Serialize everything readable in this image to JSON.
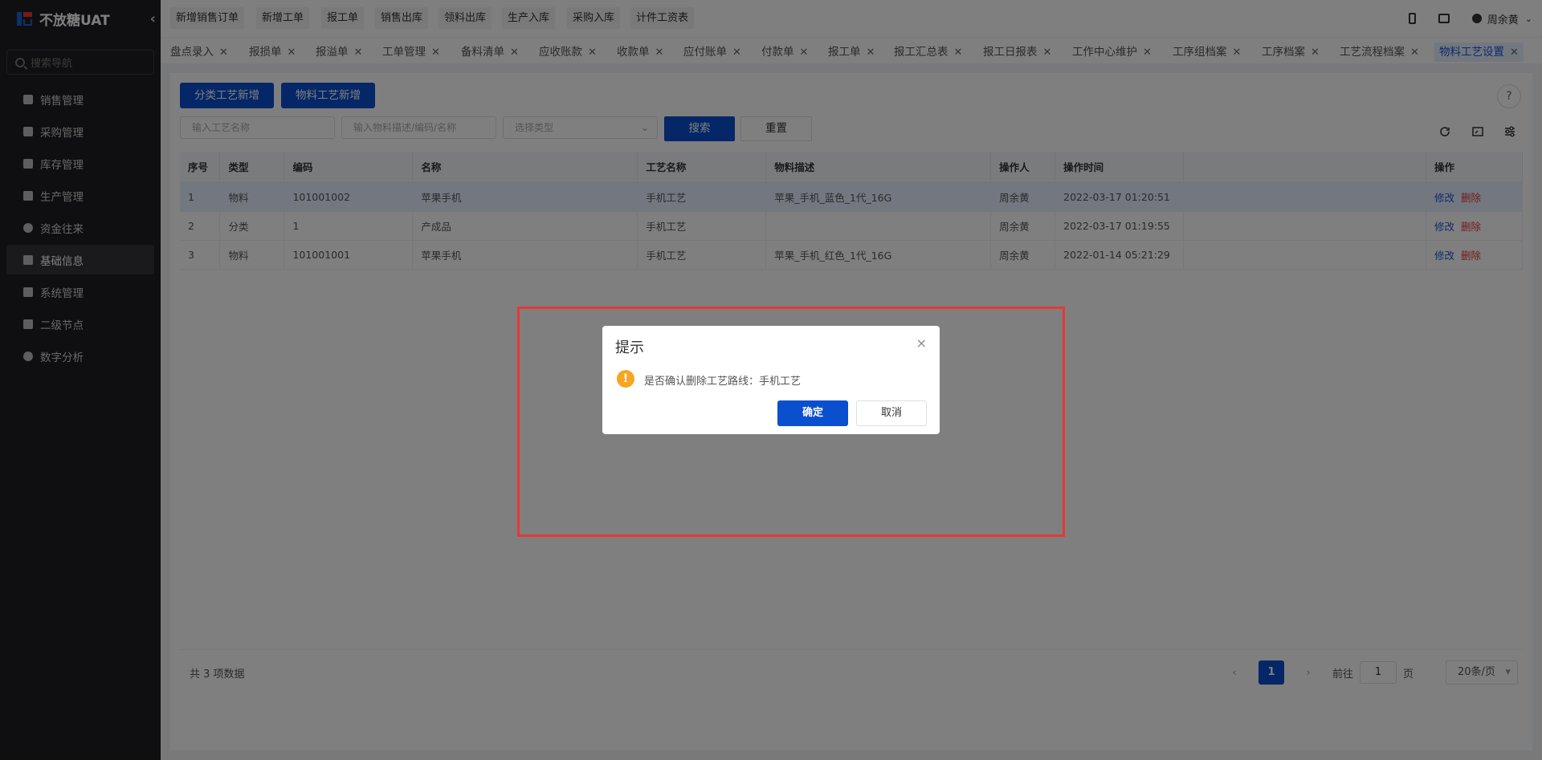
{
  "app": {
    "title": "不放糖UAT"
  },
  "sidebar": {
    "search_placeholder": "搜索导航",
    "items": [
      {
        "label": "销售管理",
        "icon": "tag-icon"
      },
      {
        "label": "采购管理",
        "icon": "cart-icon"
      },
      {
        "label": "库存管理",
        "icon": "box-icon"
      },
      {
        "label": "生产管理",
        "icon": "factory-icon"
      },
      {
        "label": "资金往来",
        "icon": "coin-icon"
      },
      {
        "label": "基础信息",
        "icon": "grid-icon"
      },
      {
        "label": "系统管理",
        "icon": "apps-icon"
      },
      {
        "label": "二级节点",
        "icon": "doc-icon"
      },
      {
        "label": "数字分析",
        "icon": "pie-icon"
      }
    ],
    "active_index": 5
  },
  "quick": [
    "新增销售订单",
    "新增工单",
    "报工单",
    "销售出库",
    "领料出库",
    "生产入库",
    "采购入库",
    "计件工资表"
  ],
  "user": {
    "name": "周余黄"
  },
  "tabs": [
    "盘点录入",
    "报损单",
    "报溢单",
    "工单管理",
    "备料清单",
    "应收账款",
    "收款单",
    "应付账单",
    "付款单",
    "报工单",
    "报工汇总表",
    "报工日报表",
    "工作中心维护",
    "工序组档案",
    "工序档案",
    "工艺流程档案",
    "物料工艺设置"
  ],
  "actions": {
    "add_category": "分类工艺新增",
    "add_material": "物料工艺新增"
  },
  "filters": {
    "process_name_placeholder": "输入工艺名称",
    "material_placeholder": "输入物料描述/编码/名称",
    "type_placeholder": "选择类型",
    "search_label": "搜索",
    "reset_label": "重置"
  },
  "table": {
    "headers": [
      "序号",
      "类型",
      "编码",
      "名称",
      "工艺名称",
      "物料描述",
      "操作人",
      "操作时间",
      "",
      "操作"
    ],
    "rows": [
      {
        "no": "1",
        "type": "物料",
        "code": "101001002",
        "name": "苹果手机",
        "process": "手机工艺",
        "desc": "苹果_手机_蓝色_1代_16G",
        "operator": "周余黄",
        "time": "2022-03-17 01:20:51"
      },
      {
        "no": "2",
        "type": "分类",
        "code": "1",
        "name": "产成品",
        "process": "手机工艺",
        "desc": "",
        "operator": "周余黄",
        "time": "2022-03-17 01:19:55"
      },
      {
        "no": "3",
        "type": "物料",
        "code": "101001001",
        "name": "苹果手机",
        "process": "手机工艺",
        "desc": "苹果_手机_红色_1代_16G",
        "operator": "周余黄",
        "time": "2022-01-14 05:21:29"
      }
    ],
    "edit_label": "修改",
    "delete_label": "删除"
  },
  "pagination": {
    "total_text": "共 3 项数据",
    "current": "1",
    "goto_label": "前往",
    "goto_value": "1",
    "page_unit": "页",
    "page_size": "20条/页"
  },
  "dialog": {
    "title": "提示",
    "message": "是否确认删除工艺路线：手机工艺",
    "ok_label": "确定",
    "cancel_label": "取消",
    "close_glyph": "×",
    "warn_glyph": "!"
  }
}
